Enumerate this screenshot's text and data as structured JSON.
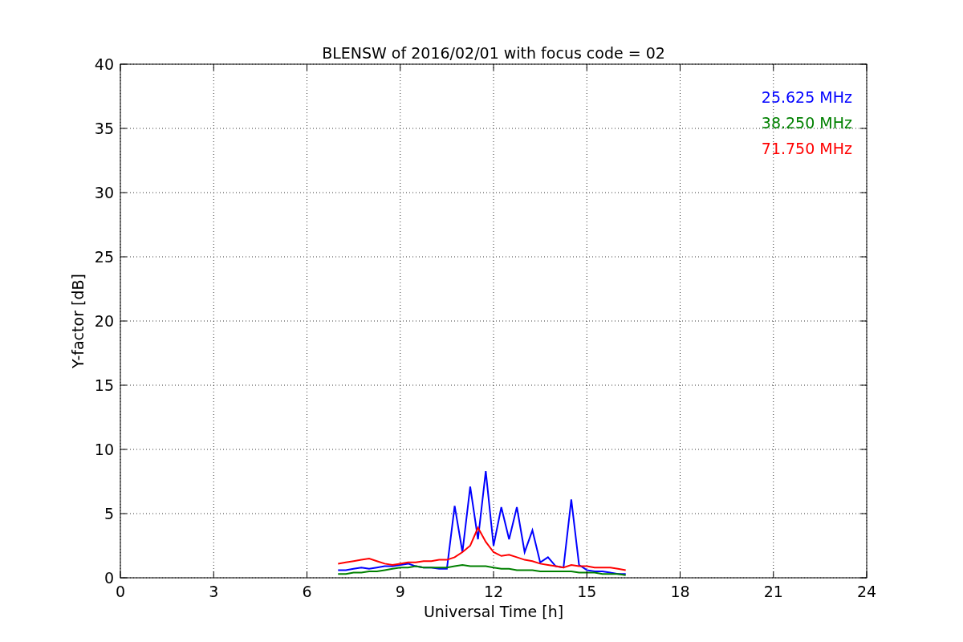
{
  "figure": {
    "chart_data": {
      "type": "line",
      "title": "BLENSW of 2016/02/01 with focus code = 02",
      "xlabel": "Universal Time [h]",
      "ylabel": "Y-factor [dB]",
      "grid": true,
      "xlim": [
        0,
        24
      ],
      "ylim": [
        0,
        40
      ],
      "xticks": [
        0,
        3,
        6,
        9,
        12,
        15,
        18,
        21,
        24
      ],
      "yticks": [
        0,
        5,
        10,
        15,
        20,
        25,
        30,
        35,
        40
      ],
      "x": [
        7,
        7.25,
        7.5,
        7.75,
        8,
        8.25,
        8.5,
        8.75,
        9,
        9.25,
        9.5,
        9.75,
        10,
        10.25,
        10.5,
        10.75,
        11,
        11.25,
        11.5,
        11.75,
        12,
        12.25,
        12.5,
        12.75,
        13,
        13.25,
        13.5,
        13.75,
        14,
        14.25,
        14.5,
        14.75,
        15,
        15.25,
        15.5,
        15.75,
        16,
        16.25
      ],
      "series": [
        {
          "name": "25.625 MHz",
          "color": "#0000ff",
          "values": [
            0.6,
            0.6,
            0.7,
            0.8,
            0.7,
            0.8,
            0.9,
            0.9,
            1.0,
            1.1,
            0.9,
            0.8,
            0.8,
            0.7,
            0.7,
            5.6,
            2.0,
            7.1,
            3.0,
            8.3,
            2.5,
            5.5,
            3.0,
            5.5,
            2.0,
            3.7,
            1.2,
            1.6,
            0.9,
            0.8,
            6.1,
            1.0,
            0.6,
            0.5,
            0.5,
            0.4,
            0.3,
            0.3
          ]
        },
        {
          "name": "38.250 MHz",
          "color": "#008000",
          "values": [
            0.3,
            0.3,
            0.4,
            0.4,
            0.5,
            0.5,
            0.6,
            0.7,
            0.8,
            0.8,
            0.9,
            0.8,
            0.8,
            0.8,
            0.8,
            0.9,
            1.0,
            0.9,
            0.9,
            0.9,
            0.8,
            0.7,
            0.7,
            0.6,
            0.6,
            0.6,
            0.5,
            0.5,
            0.5,
            0.5,
            0.5,
            0.4,
            0.4,
            0.4,
            0.3,
            0.3,
            0.3,
            0.2
          ]
        },
        {
          "name": "71.750 MHz",
          "color": "#ff0000",
          "values": [
            1.1,
            1.2,
            1.3,
            1.4,
            1.5,
            1.3,
            1.1,
            1.0,
            1.1,
            1.2,
            1.2,
            1.3,
            1.3,
            1.4,
            1.4,
            1.6,
            2.0,
            2.5,
            3.9,
            2.8,
            2.0,
            1.7,
            1.8,
            1.6,
            1.4,
            1.3,
            1.1,
            1.0,
            0.9,
            0.8,
            1.0,
            0.9,
            0.9,
            0.8,
            0.8,
            0.8,
            0.7,
            0.6
          ]
        }
      ]
    }
  }
}
